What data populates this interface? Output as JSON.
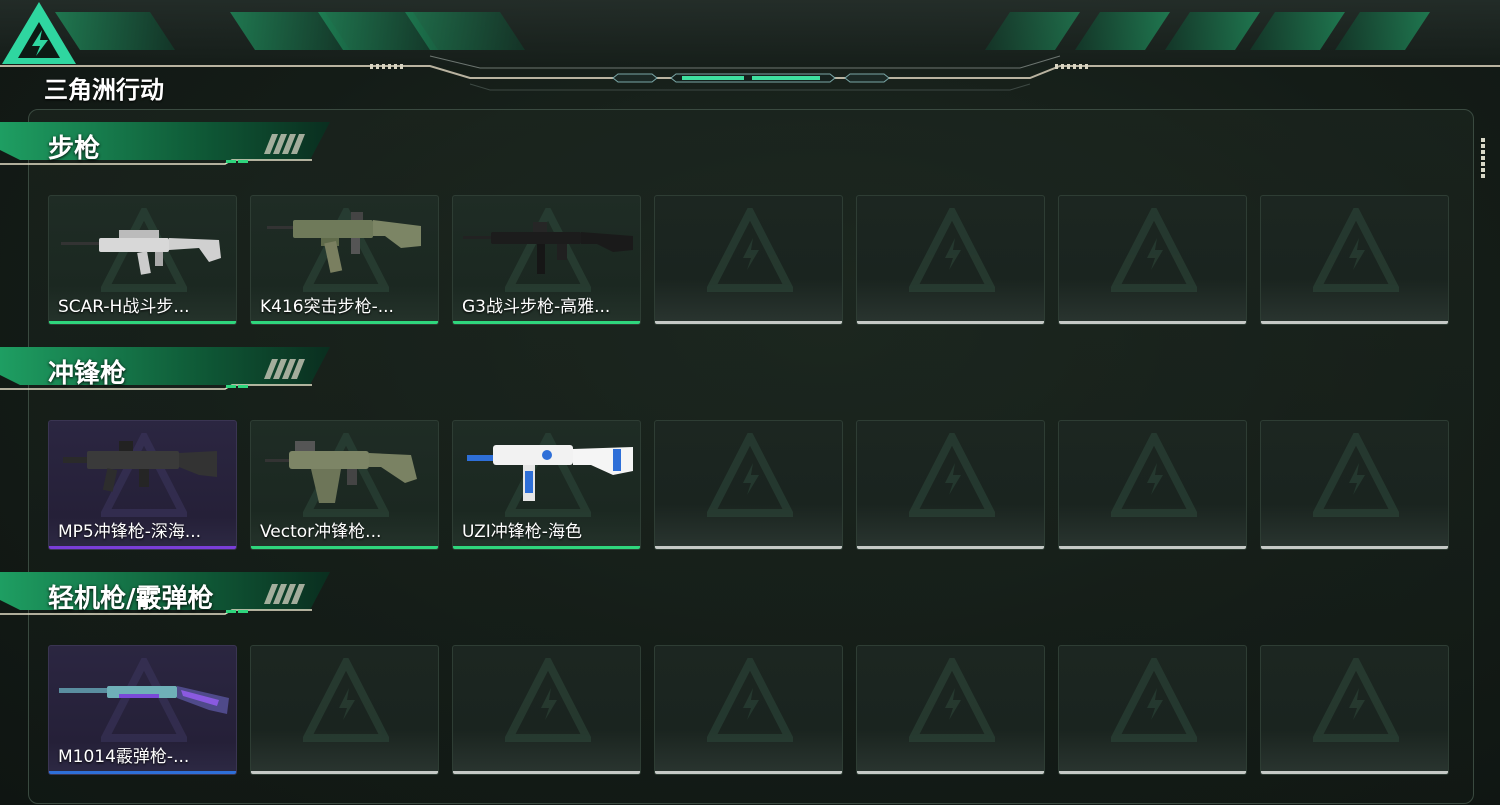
{
  "app": {
    "logo_text": "三角洲行动"
  },
  "colors": {
    "accent_green": "#2fd67d",
    "rarity_purple": "#7a3ed8",
    "rarity_blue": "#2e6fd8",
    "empty_bar": "#c5c9c6"
  },
  "categories": [
    {
      "title": "步枪",
      "items": [
        {
          "label": "SCAR-H战斗步...",
          "rarity": "green",
          "icon": "scar-h-rifle-icon"
        },
        {
          "label": "K416突击步枪-...",
          "rarity": "green",
          "icon": "k416-rifle-icon"
        },
        {
          "label": "G3战斗步枪-高雅...",
          "rarity": "green",
          "icon": "g3-rifle-icon"
        },
        {
          "label": "",
          "rarity": "empty"
        },
        {
          "label": "",
          "rarity": "empty"
        },
        {
          "label": "",
          "rarity": "empty"
        },
        {
          "label": "",
          "rarity": "empty"
        }
      ]
    },
    {
      "title": "冲锋枪",
      "items": [
        {
          "label": "MP5冲锋枪-深海...",
          "rarity": "purple",
          "icon": "mp5-smg-icon"
        },
        {
          "label": "Vector冲锋枪...",
          "rarity": "green",
          "icon": "vector-smg-icon"
        },
        {
          "label": "UZI冲锋枪-海色",
          "rarity": "green",
          "icon": "uzi-smg-icon"
        },
        {
          "label": "",
          "rarity": "empty"
        },
        {
          "label": "",
          "rarity": "empty"
        },
        {
          "label": "",
          "rarity": "empty"
        },
        {
          "label": "",
          "rarity": "empty"
        }
      ]
    },
    {
      "title": "轻机枪/霰弹枪",
      "items": [
        {
          "label": "M1014霰弹枪-...",
          "rarity": "blue",
          "icon": "m1014-shotgun-icon"
        },
        {
          "label": "",
          "rarity": "empty"
        },
        {
          "label": "",
          "rarity": "empty"
        },
        {
          "label": "",
          "rarity": "empty"
        },
        {
          "label": "",
          "rarity": "empty"
        },
        {
          "label": "",
          "rarity": "empty"
        },
        {
          "label": "",
          "rarity": "empty"
        }
      ]
    }
  ]
}
